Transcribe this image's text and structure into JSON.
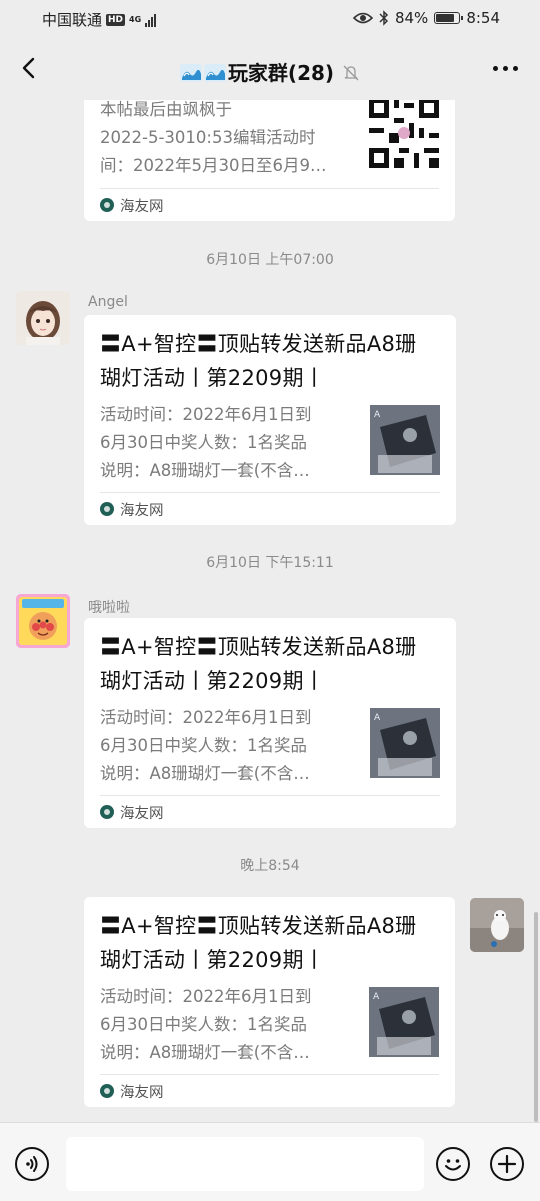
{
  "status_bar": {
    "carrier": "中国联通",
    "hd_badge": "HD",
    "network": "4G",
    "battery_text": "84%",
    "battery_level": 0.84,
    "time": "8:54"
  },
  "header": {
    "title": "玩家群(28)",
    "icons": [
      "back-icon",
      "wave-icon",
      "mute-icon",
      "more-icon"
    ]
  },
  "messages": [
    {
      "desc": [
        "本帖最后由飒枫于",
        "2022-5-3010:53编辑活动时",
        "间：2022年5月30日至6月9…"
      ],
      "source": "海友网"
    },
    {
      "timestamp": "6月10日 上午07:00",
      "sender": "Angel",
      "title": [
        "〓A+智控〓顶贴转发送新品A8珊",
        "瑚灯活动丨第2209期丨"
      ],
      "desc": [
        "活动时间：2022年6月1日到",
        "6月30日中奖人数：1名奖品",
        "说明：A8珊瑚灯一套(不含…"
      ],
      "source": "海友网"
    },
    {
      "timestamp": "6月10日 下午15:11",
      "sender": "哦啦啦",
      "title": [
        "〓A+智控〓顶贴转发送新品A8珊",
        "瑚灯活动丨第2209期丨"
      ],
      "desc": [
        "活动时间：2022年6月1日到",
        "6月30日中奖人数：1名奖品",
        "说明：A8珊瑚灯一套(不含…"
      ],
      "source": "海友网"
    },
    {
      "timestamp": "晚上8:54",
      "title": [
        "〓A+智控〓顶贴转发送新品A8珊",
        "瑚灯活动丨第2209期丨"
      ],
      "desc": [
        "活动时间：2022年6月1日到",
        "6月30日中奖人数：1名奖品",
        "说明：A8珊瑚灯一套(不含…"
      ],
      "source": "海友网"
    }
  ],
  "input_bar": {
    "icons": [
      "voice-icon",
      "emoji-icon",
      "plus-icon"
    ]
  },
  "colors": {
    "background": "#ededed",
    "card": "#ffffff",
    "muted_text": "#7b7b7b"
  }
}
